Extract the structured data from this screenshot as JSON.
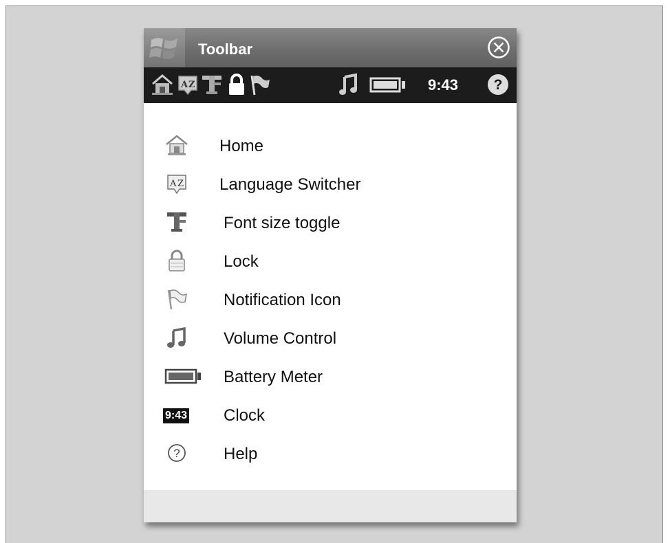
{
  "window": {
    "title": "Toolbar"
  },
  "statusbar": {
    "clock": "9:43"
  },
  "menu": {
    "items": [
      {
        "label": "Home",
        "icon": "home-icon"
      },
      {
        "label": "Language Switcher",
        "icon": "language-icon"
      },
      {
        "label": "Font size toggle",
        "icon": "font-size-icon"
      },
      {
        "label": "Lock",
        "icon": "lock-icon"
      },
      {
        "label": "Notification Icon",
        "icon": "flag-icon"
      },
      {
        "label": "Volume Control",
        "icon": "music-note-icon"
      },
      {
        "label": "Battery Meter",
        "icon": "battery-icon"
      },
      {
        "label": "Clock",
        "icon": "clock-icon",
        "badge": "9:43"
      },
      {
        "label": "Help",
        "icon": "help-icon"
      }
    ]
  },
  "colors": {
    "background": "#d3d3d3",
    "titlebar": "#6e6e6e",
    "statusbar": "#1c1c1c",
    "content": "#ffffff",
    "footer": "#e8e8e8"
  }
}
